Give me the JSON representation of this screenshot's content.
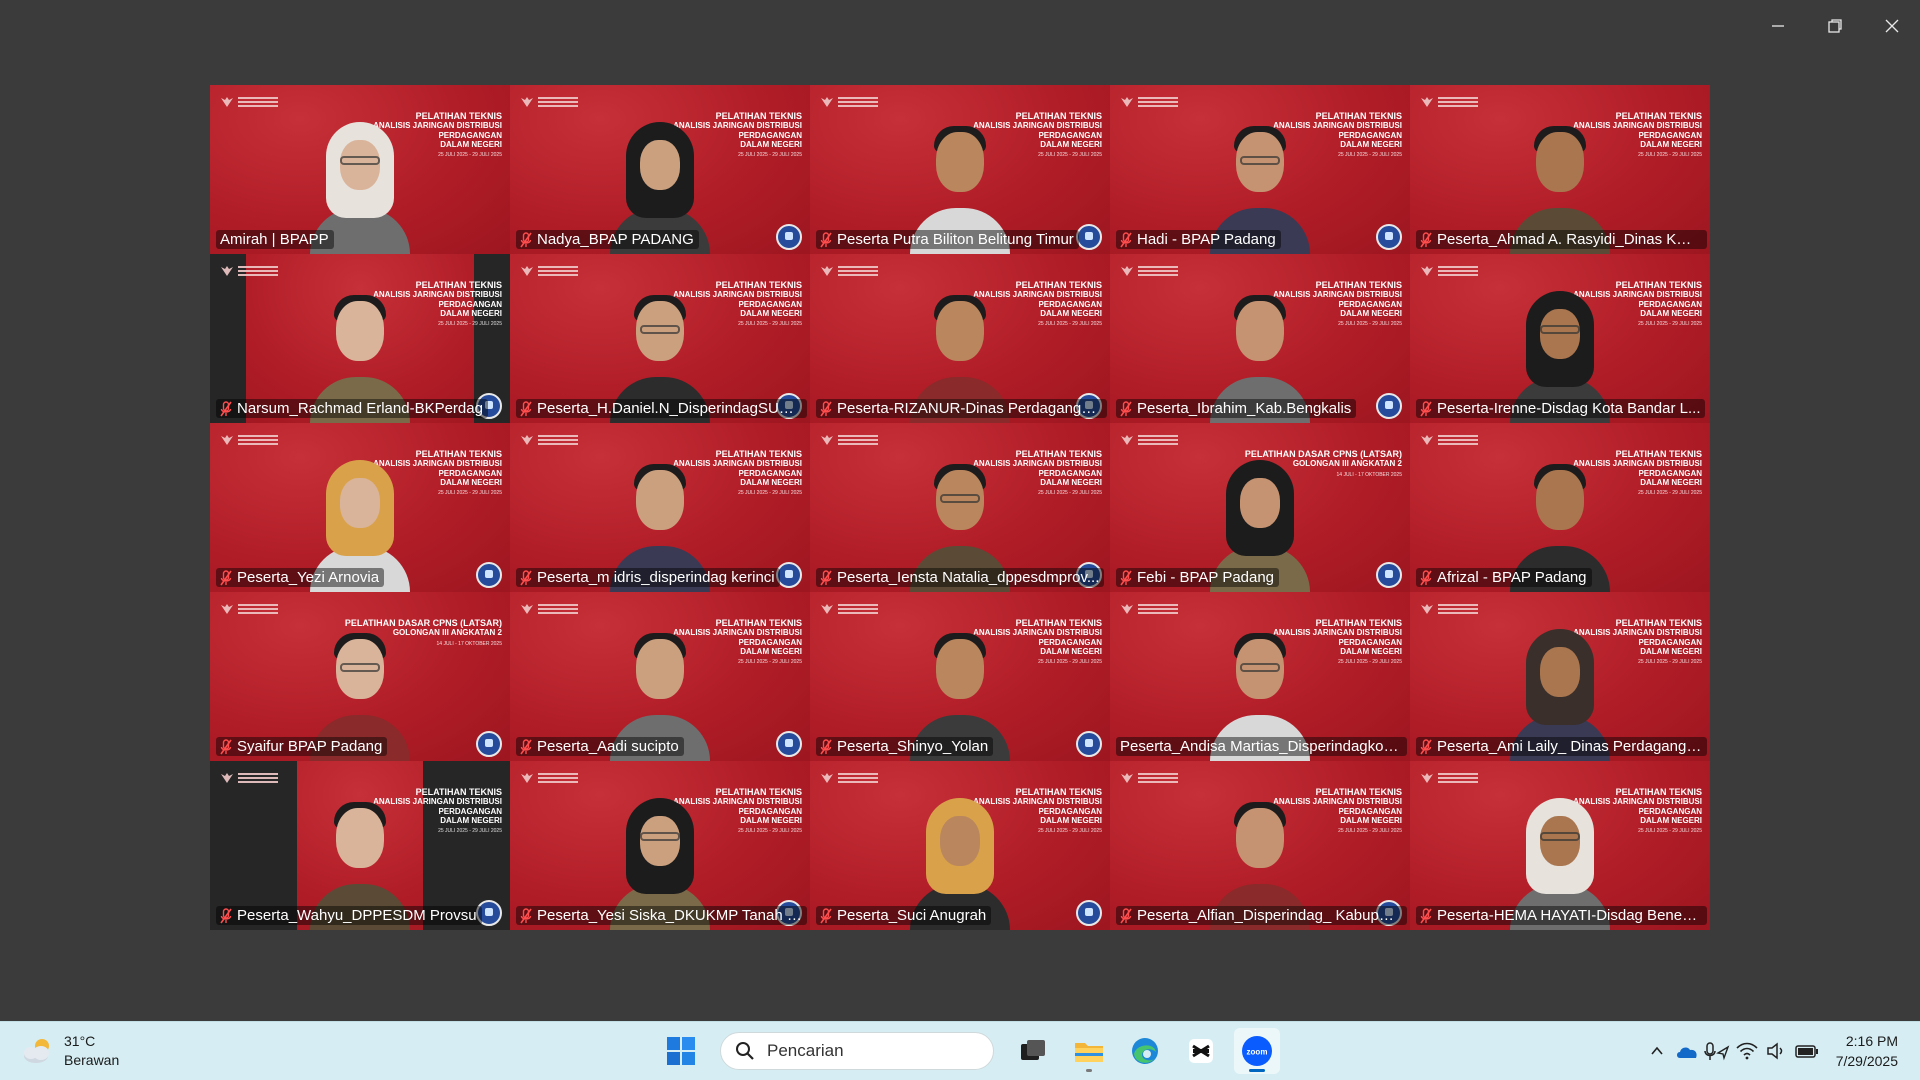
{
  "window": {
    "controls": {
      "minimize": "minimize-icon",
      "restore": "restore-icon",
      "close": "close-icon"
    }
  },
  "gallery": {
    "active_border_color": "#2ee58a",
    "tile_background_color": "#b5202a",
    "banner": {
      "line1": "PELATIHAN TEKNIS",
      "line2": "ANALISIS JARINGAN DISTRIBUSI PERDAGANGAN",
      "line3": "DALAM NEGERI",
      "line4": "25 JULI 2025 - 29 JULI 2025"
    },
    "banner_alt": {
      "line1": "PELATIHAN DASAR CPNS (LATSAR)",
      "line2": "GOLONGAN III ANGKATAN 2",
      "line4": "14 JULI - 17 OKTOBER 2025"
    },
    "participants": [
      {
        "name": "Amirah | BPAPP",
        "muted": false,
        "active": true
      },
      {
        "name": "Nadya_BPAP PADANG",
        "muted": true
      },
      {
        "name": "Peserta Putra Biliton Belitung Timur",
        "muted": true
      },
      {
        "name": "Hadi - BPAP Padang",
        "muted": true
      },
      {
        "name": "Peserta_Ahmad A. Rasyidi_Dinas KUK...",
        "muted": true
      },
      {
        "name": "Narsum_Rachmad Erland-BKPerdag",
        "muted": true
      },
      {
        "name": "Peserta_H.Daniel.N_DisperindagSUm...",
        "muted": true
      },
      {
        "name": "Peserta-RIZANUR-Dinas Perdaganga...",
        "muted": true
      },
      {
        "name": "Peserta_Ibrahim_Kab.Bengkalis",
        "muted": true
      },
      {
        "name": "Peserta-Irenne-Disdag Kota Bandar L...",
        "muted": true
      },
      {
        "name": "Peserta_Yezi Arnovia",
        "muted": true
      },
      {
        "name": "Peserta_m idris_disperindag kerinci",
        "muted": true
      },
      {
        "name": "Peserta_Iensta Natalia_dppesdmprov...",
        "muted": true
      },
      {
        "name": "Febi - BPAP Padang",
        "muted": true
      },
      {
        "name": "Afrizal - BPAP Padang",
        "muted": true
      },
      {
        "name": "Syaifur BPAP Padang",
        "muted": true
      },
      {
        "name": "Peserta_Aadi sucipto",
        "muted": true
      },
      {
        "name": "Peserta_Shinyo_Yolan",
        "muted": true
      },
      {
        "name": "Peserta_Andisa Martias_Disperindagkop...",
        "muted": false
      },
      {
        "name": "Peserta_Ami Laily_ Dinas Perdaganga...",
        "muted": true
      },
      {
        "name": "Peserta_Wahyu_DPPESDM Provsu",
        "muted": true
      },
      {
        "name": "Peserta_Yesi Siska_DKUKMP Tanah D...",
        "muted": true
      },
      {
        "name": "Peserta_Suci Anugrah",
        "muted": true
      },
      {
        "name": "Peserta_Alfian_Disperindag_ Kabupat...",
        "muted": true
      },
      {
        "name": "Peserta-HEMA HAYATI-Disdag Bener ...",
        "muted": true
      }
    ]
  },
  "taskbar": {
    "weather": {
      "temp": "31°C",
      "condition": "Berawan",
      "icon": "partly-cloudy-icon"
    },
    "search": {
      "placeholder": "Pencarian"
    },
    "apps": [
      "start-icon",
      "task-view-icon",
      "file-explorer-icon",
      "edge-icon",
      "capcut-icon",
      "zoom-icon"
    ],
    "apps_active": "zoom-icon",
    "tray": [
      "chevron-up-icon",
      "onedrive-icon",
      "mic-location-icon",
      "wifi-icon",
      "volume-icon",
      "battery-icon"
    ],
    "clock": {
      "time": "2:16 PM",
      "date": "7/29/2025"
    },
    "accent_color": "#0067c0",
    "background_color": "#d6eef3"
  }
}
